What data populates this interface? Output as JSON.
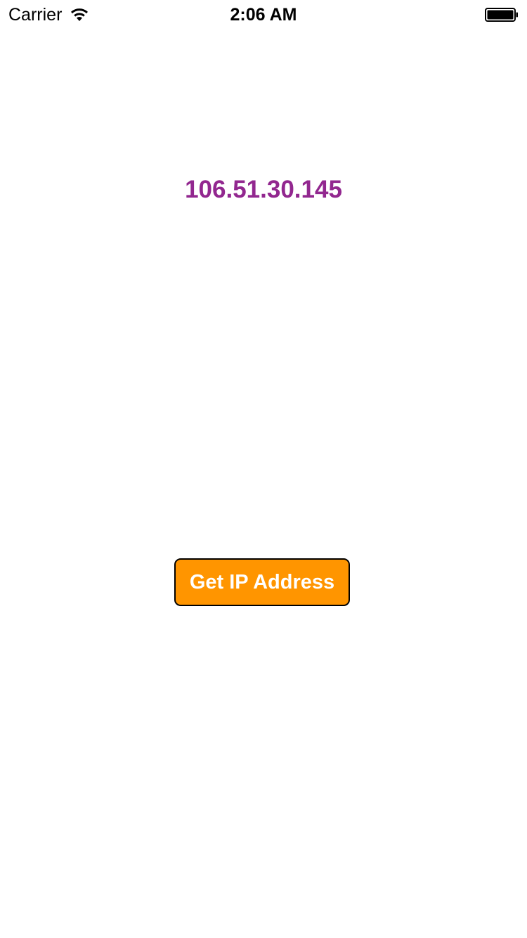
{
  "status_bar": {
    "carrier": "Carrier",
    "time": "2:06 AM",
    "wifi_icon": "wifi-icon",
    "battery_icon": "battery-full-icon",
    "battery_level": 1.0
  },
  "main": {
    "ip_address": "106.51.30.145",
    "ip_color": "#92278f",
    "button_label": "Get IP Address",
    "button_color": "#ff9500",
    "button_text_color": "#ffffff"
  }
}
